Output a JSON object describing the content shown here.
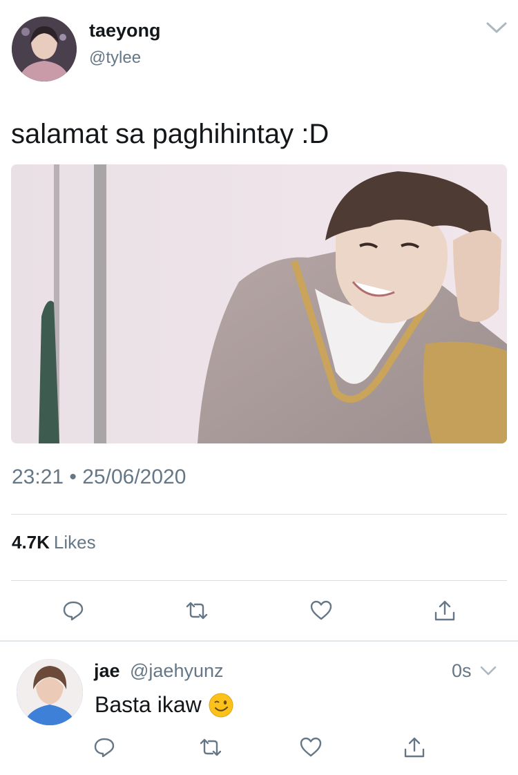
{
  "tweet": {
    "display_name": "taeyong",
    "handle": "@tylee",
    "text": "salamat sa paghihintay :D",
    "timestamp": "23:21 • 25/06/2020",
    "likes_count": "4.7K",
    "likes_label": "Likes",
    "icons": {
      "menu": "chevron-down-icon",
      "reply": "reply-icon",
      "retweet": "retweet-icon",
      "like": "heart-icon",
      "share": "share-icon"
    }
  },
  "reply": {
    "display_name": "jae",
    "handle": "@jaehyunz",
    "time": "0s",
    "text": "Basta ikaw",
    "emoji": "winking-face-emoji"
  },
  "colors": {
    "text_primary": "#14171a",
    "text_secondary": "#657786",
    "divider": "#d8dde1",
    "icon": "#657786"
  }
}
